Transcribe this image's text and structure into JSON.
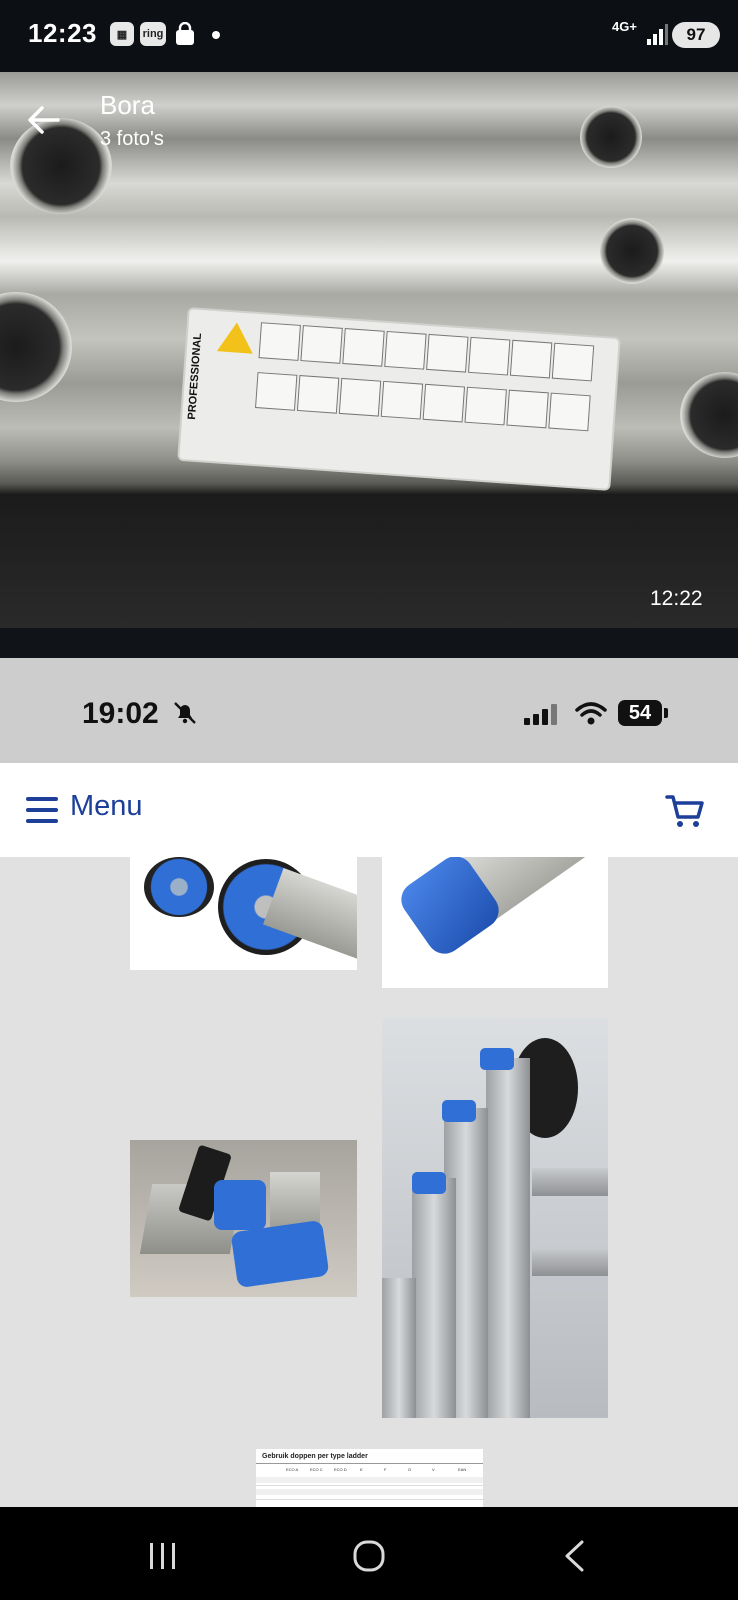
{
  "status_bar": {
    "time": "12:23",
    "network": "4G+",
    "battery": "97",
    "app_icons": [
      "gallery-icon",
      "ring-icon",
      "shopping-bag-icon"
    ],
    "ring_text": "ring"
  },
  "photo_viewer": {
    "title": "Bora",
    "subtitle": "3 foto's",
    "timestamp": "12:22",
    "sticker_label": "PROFESSIONAL"
  },
  "embedded_screenshot": {
    "status": {
      "time": "19:02",
      "battery": "54"
    },
    "menu_label": "Menu",
    "product_images": [
      "wheel-cap-image",
      "blue-end-cap-image",
      "blue-foot-pads-image",
      "ladder-wheel-image",
      "size-table-image"
    ],
    "table": {
      "title": "Gebruik doppen per type ladder",
      "headers": [
        "ECO A",
        "ECO C",
        "ECO D",
        "E",
        "F",
        "G",
        "V",
        "EAN"
      ]
    }
  },
  "colors": {
    "accent": "#1d3f9a",
    "product_blue": "#2f6fd6"
  }
}
